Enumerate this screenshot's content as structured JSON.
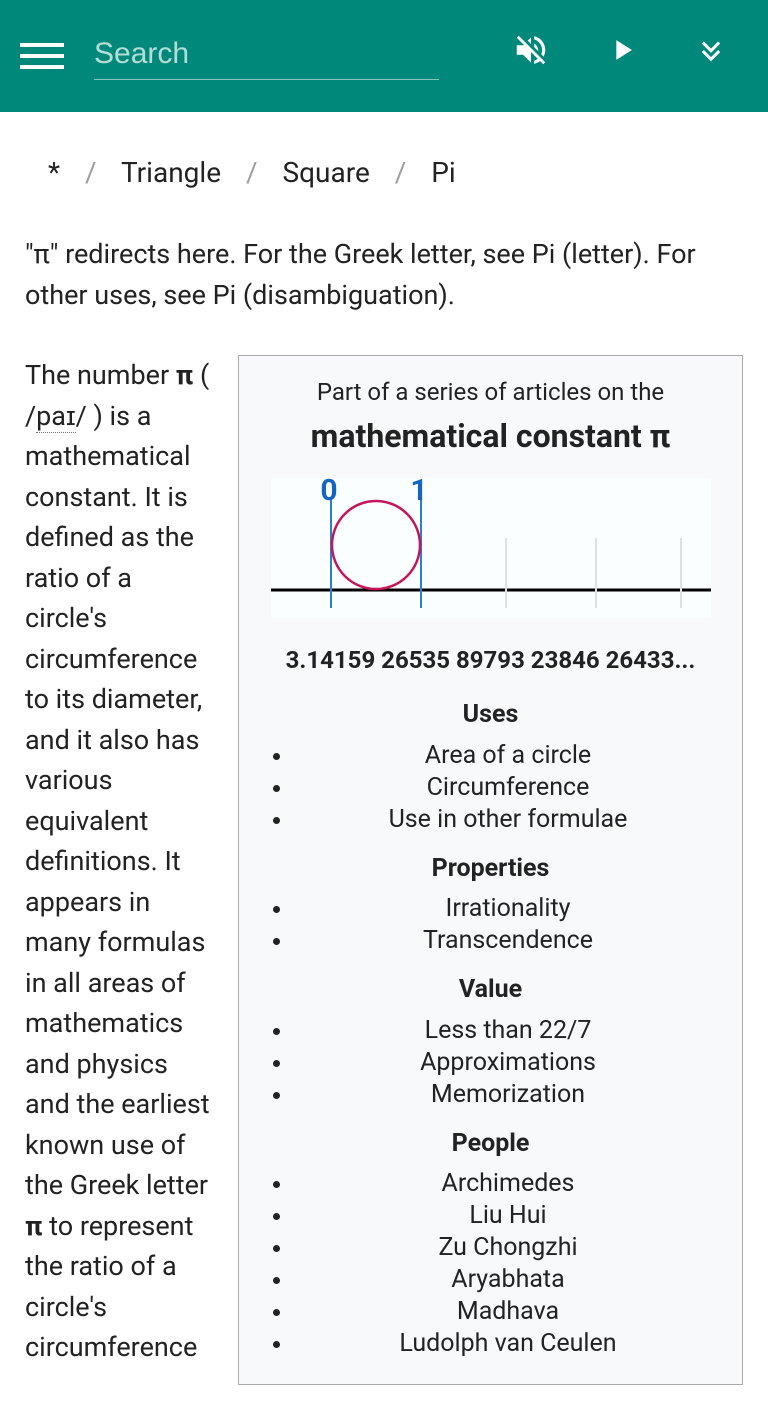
{
  "header": {
    "search_placeholder": "Search"
  },
  "breadcrumb": {
    "root": "*",
    "items": [
      "Triangle",
      "Square",
      "Pi"
    ]
  },
  "redirect_note": "\"π\" redirects here. For the Greek letter, see Pi (letter). For other uses, see Pi (disambiguation).",
  "body": {
    "lead_1": "The number ",
    "pi_bold_1": "π",
    "lead_2": " ( /",
    "pron": "paɪ",
    "lead_3": "/ ) is a mathematical constant. It is defined as the ratio of a circle's circumference to its diameter, and it also has various equivalent definitions. It appears in many formulas in all areas of mathematics and physics and the earliest known use of the Greek letter ",
    "pi_bold_2": "π",
    "lead_4": " to represent the ratio of a circle's circumference"
  },
  "infobox": {
    "subtitle": "Part of a series of articles on the",
    "title": "mathematical constant π",
    "diagram_labels": {
      "zero": "0",
      "one": "1"
    },
    "digits": "3.14159 26535 89793 23846 26433...",
    "sections": [
      {
        "heading": "Uses",
        "items": [
          "Area of a circle",
          "Circumference",
          "Use in other formulae"
        ]
      },
      {
        "heading": "Properties",
        "items": [
          "Irrationality",
          "Transcendence"
        ]
      },
      {
        "heading": "Value",
        "items": [
          "Less than 22/7",
          "Approximations",
          "Memorization"
        ]
      },
      {
        "heading": "People",
        "items": [
          "Archimedes",
          "Liu Hui",
          "Zu Chongzhi",
          "Aryabhata",
          "Madhava",
          "Ludolph van Ceulen"
        ]
      }
    ]
  }
}
